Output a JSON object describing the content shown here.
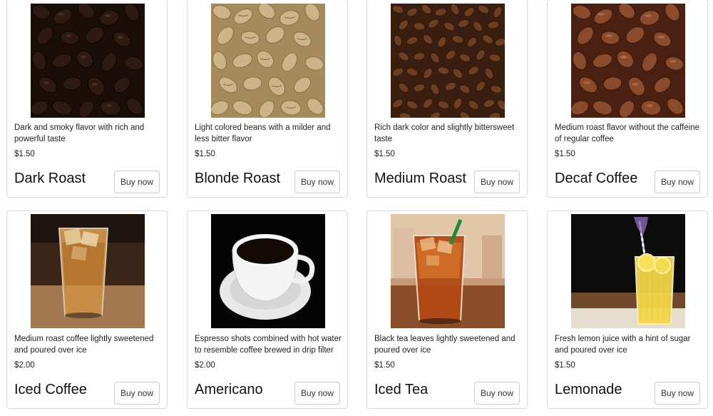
{
  "products": [
    {
      "name": "Dark Roast",
      "description": "Dark and smoky flavor with rich and powerful taste",
      "price": "$1.50",
      "button": "Buy now",
      "image": "dark-roast-beans-image"
    },
    {
      "name": "Blonde Roast",
      "description": "Light colored beans with a milder and less bitter flavor",
      "price": "$1.50",
      "button": "Buy now",
      "image": "blonde-roast-beans-image"
    },
    {
      "name": "Medium Roast",
      "description": "Rich dark color and slightly bittersweet taste",
      "price": "$1.50",
      "button": "Buy now",
      "image": "medium-roast-beans-image"
    },
    {
      "name": "Decaf Coffee",
      "description": "Medium roast flavor without the caffeine of regular coffee",
      "price": "$1.50",
      "button": "Buy now",
      "image": "decaf-beans-image"
    },
    {
      "name": "Iced Coffee",
      "description": "Medium roast coffee lightly sweetened and poured over ice",
      "price": "$2.00",
      "button": "Buy now",
      "image": "iced-coffee-image"
    },
    {
      "name": "Americano",
      "description": "Espresso shots combined with hot water to resemble coffee brewed in drip filter",
      "price": "$2.00",
      "button": "Buy now",
      "image": "americano-cup-image"
    },
    {
      "name": "Iced Tea",
      "description": "Black tea leaves lightly sweetened and poured over ice",
      "price": "$1.50",
      "button": "Buy now",
      "image": "iced-tea-image"
    },
    {
      "name": "Lemonade",
      "description": "Fresh lemon juice with a hint of sugar and poured over ice",
      "price": "$1.50",
      "button": "Buy now",
      "image": "lemonade-image"
    }
  ]
}
